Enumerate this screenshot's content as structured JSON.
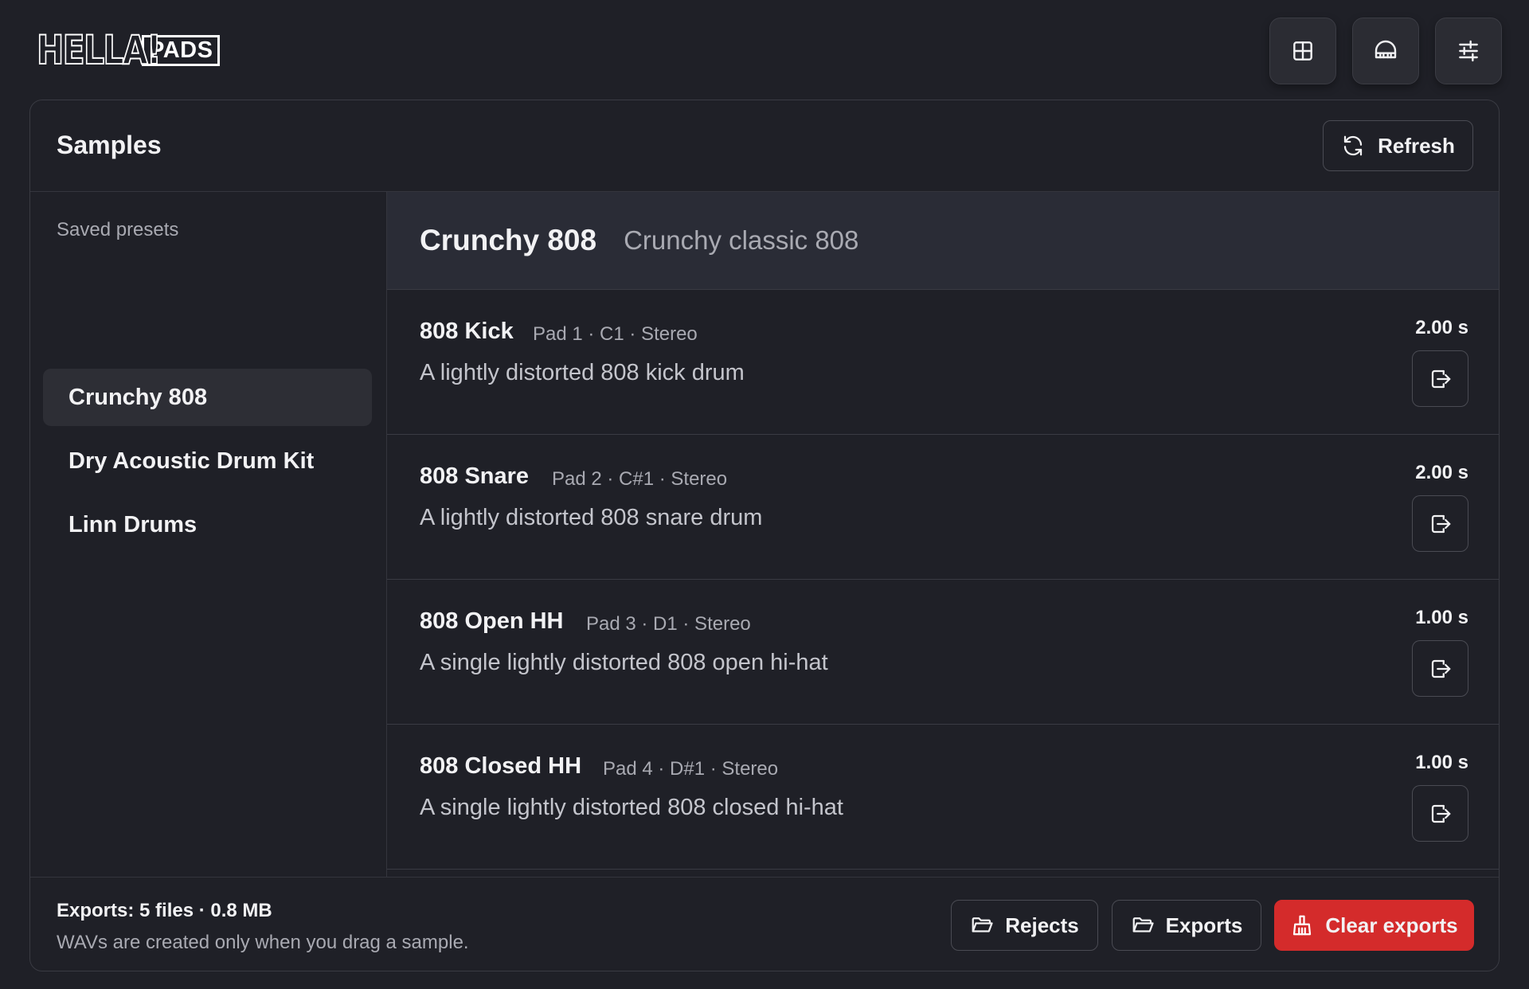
{
  "app": {
    "logo_main": "HELLA!",
    "logo_sub": "PADS"
  },
  "toolbar": {
    "buttons": [
      {
        "icon": "grid-icon"
      },
      {
        "icon": "piano-icon"
      },
      {
        "icon": "sliders-icon"
      }
    ]
  },
  "panel": {
    "title": "Samples",
    "refresh_label": "Refresh"
  },
  "sidebar": {
    "heading": "Saved presets",
    "presets": [
      {
        "label": "Crunchy 808",
        "active": true
      },
      {
        "label": "Dry Acoustic Drum Kit",
        "active": false
      },
      {
        "label": "Linn Drums",
        "active": false
      }
    ]
  },
  "preset": {
    "title": "Crunchy 808",
    "subtitle": "Crunchy classic 808"
  },
  "samples": [
    {
      "name": "808 Kick",
      "meta": "Pad 1 · C1 · Stereo",
      "description": "A lightly distorted 808 kick drum",
      "duration": "2.00 s"
    },
    {
      "name": "808 Snare",
      "meta": "Pad 2 · C#1 · Stereo",
      "description": "A lightly distorted 808 snare drum",
      "duration": "2.00 s"
    },
    {
      "name": "808 Open HH",
      "meta": "Pad 3 · D1 · Stereo",
      "description": "A single lightly distorted 808 open hi-hat",
      "duration": "1.00 s"
    },
    {
      "name": "808 Closed HH",
      "meta": "Pad 4 · D#1 · Stereo",
      "description": "A single lightly distorted 808 closed hi-hat",
      "duration": "1.00 s"
    }
  ],
  "footer": {
    "stats": "Exports: 5 files · 0.8 MB",
    "note": "WAVs are created only when you drag a sample.",
    "rejects_label": "Rejects",
    "exports_label": "Exports",
    "clear_label": "Clear exports"
  },
  "colors": {
    "background": "#1f2027",
    "danger": "#d42b2b",
    "selected": "#2d2e35"
  }
}
